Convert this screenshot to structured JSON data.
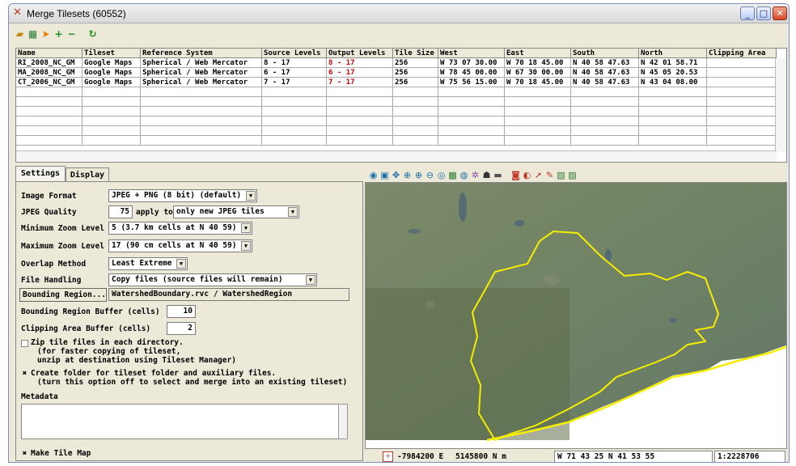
{
  "window": {
    "title": "Merge Tilesets (60552)"
  },
  "toolbar": {
    "icons": [
      "open-folder-icon",
      "tileset-icon",
      "arrow-icon",
      "add-icon",
      "remove-icon",
      "refresh-icon"
    ],
    "add": "+",
    "remove": "−",
    "refresh": "↻"
  },
  "table": {
    "columns": [
      "Name",
      "Tileset",
      "Reference System",
      "Source Levels",
      "Output Levels",
      "Tile Size",
      "West",
      "East",
      "South",
      "North",
      "Clipping Area"
    ],
    "rows": [
      [
        "RI_2008_NC_GM",
        "Google Maps",
        "Spherical / Web Mercator",
        "8 - 17",
        "8 - 17",
        "256",
        "W 73 07 30.00",
        "W 70 18 45.00",
        "N 40 58 47.63",
        "N 42 01 58.71",
        ""
      ],
      [
        "MA_2008_NC_GM",
        "Google Maps",
        "Spherical / Web Mercator",
        "6 - 17",
        "6 - 17",
        "256",
        "W 78 45 00.00",
        "W 67 30 00.00",
        "N 40 58 47.63",
        "N 45 05 20.53",
        ""
      ],
      [
        "CT_2006_NC_GM",
        "Google Maps",
        "Spherical / Web Mercator",
        "7 - 17",
        "7 - 17",
        "256",
        "W 75 56 15.00",
        "W 70 18 45.00",
        "N 40 58 47.63",
        "N 43 04 08.00",
        ""
      ]
    ]
  },
  "tabs": {
    "settings": "Settings",
    "display": "Display"
  },
  "settings": {
    "image_format_label": "Image Format",
    "image_format_value": "JPEG + PNG (8 bit) (default)",
    "jpeg_quality_label": "JPEG Quality",
    "jpeg_quality_value": "75",
    "apply_to_label": "apply to",
    "apply_to_value": "only new JPEG tiles",
    "min_zoom_label": "Minimum Zoom Level",
    "min_zoom_value": "5 (3.7 km cells at N 40 59)",
    "max_zoom_label": "Maximum Zoom Level",
    "max_zoom_value": "17 (90 cm cells at N 40 59)",
    "overlap_label": "Overlap Method",
    "overlap_value": "Least Extreme",
    "file_handling_label": "File Handling",
    "file_handling_value": "Copy files (source files will remain)",
    "bounding_region_button": "Bounding Region...",
    "bounding_region_value": "WatershedBoundary.rvc / WatershedRegion",
    "bounding_buffer_label": "Bounding Region Buffer (cells)",
    "bounding_buffer_value": "10",
    "clipping_buffer_label": "Clipping Area Buffer (cells)",
    "clipping_buffer_value": "2",
    "zip_line1": "Zip tile files in each directory.",
    "zip_line2": "(for faster copying of tileset,",
    "zip_line3": "unzip at destination using Tileset Manager)",
    "zip_checked": false,
    "folder_line1": "Create folder for tileset folder and auxiliary files.",
    "folder_line2": "(turn this option off to select and merge into an existing tileset)",
    "folder_checked": true,
    "metadata_label": "Metadata",
    "make_tile_map_label": "Make Tile Map",
    "make_tile_map_checked": true
  },
  "status": {
    "easting": "-7984200 E",
    "northing": "5145800 N m",
    "latlon": "W 71 43 25  N 41 53 55",
    "scale": "1:2228706"
  },
  "colors": {
    "boundary": "#f5ee00",
    "output_levels": "#d00000"
  }
}
